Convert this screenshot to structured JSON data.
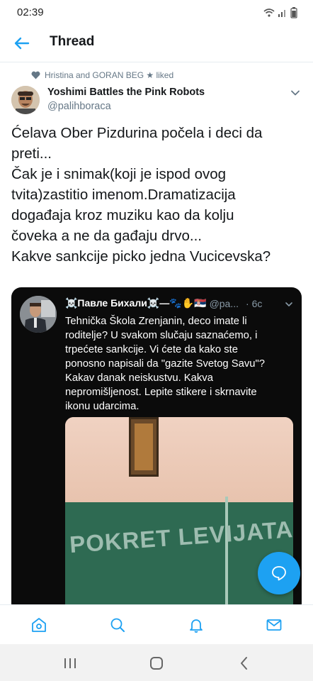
{
  "status_bar": {
    "time": "02:39",
    "icons": [
      "wifi-icon",
      "signal-icon",
      "battery-icon"
    ]
  },
  "header": {
    "back_icon": "arrow-left-icon",
    "title": "Thread"
  },
  "liked": {
    "icon": "heart-icon",
    "text": "Hristina and GORAN BEG ★ liked"
  },
  "tweet": {
    "author_name": "Yoshimi Battles the Pink Robots",
    "author_handle": "@palihboraca",
    "lines": [
      "Ćelava Ober Pizdurina počela i deci da",
      "preti...",
      "Čak je i snimak(koji je ispod ovog",
      "tvita)zastitio imenom.Dramatizacija",
      "događaja kroz muziku kao da kolju",
      "čoveka a ne da gađaju drvo...",
      "Kakve sankcije picko jedna Vucicevska?"
    ]
  },
  "quoted_tweet": {
    "author_name": "☠️Павле Бихали☠️—🐾✋🇷🇸",
    "author_handle": "@pa...",
    "time": "· 6c",
    "lines": [
      "Tehnička Škola Zrenjanin, deco imate li",
      "roditelje? U svakom slučaju saznaćemo, i",
      "trpećete sankcije. Vi ćete da kako ste",
      "ponosno napisali da \"gazite Svetog Savu\"?",
      "Kakav danak neiskustvu. Kakva",
      "nepromišljenost. Lepite stikere i skrnavite",
      "ikonu udarcima."
    ],
    "media_text": "POKRET LEVIJATAN"
  },
  "bottom_nav": {
    "items": [
      "home-icon",
      "search-icon",
      "notifications-icon",
      "messages-icon"
    ]
  },
  "android_nav": {
    "items": [
      "recents-icon",
      "home-button-icon",
      "back-icon"
    ]
  },
  "colors": {
    "accent": "#1da1f2",
    "text_secondary": "#657786"
  }
}
